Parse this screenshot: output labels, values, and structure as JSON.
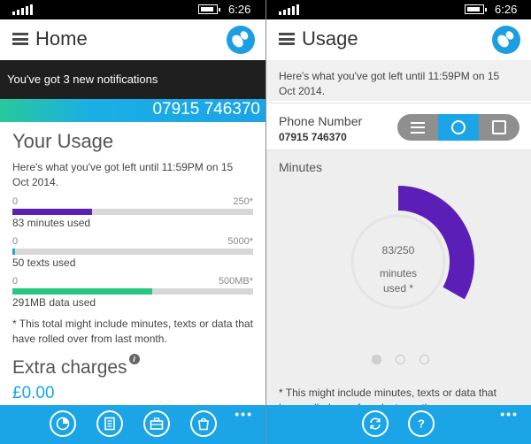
{
  "status_bar": {
    "time": "6:26"
  },
  "home": {
    "header": {
      "title": "Home"
    },
    "notification": "You've got 3 new notifications",
    "phone_number": "07915 746370",
    "usage": {
      "title": "Your Usage",
      "until_text": "Here's what you've got left until 11:59PM on 15 Oct 2014.",
      "meters": [
        {
          "min_label": "0",
          "max_label": "250*",
          "used": 83,
          "total": 250,
          "caption": "83 minutes used",
          "color": "#5b1fb7"
        },
        {
          "min_label": "0",
          "max_label": "5000*",
          "used": 50,
          "total": 5000,
          "caption": "50 texts used",
          "color": "#1ba4e6"
        },
        {
          "min_label": "0",
          "max_label": "500MB*",
          "used": 291,
          "total": 500,
          "caption": "291MB data used",
          "color": "#26c87d"
        }
      ],
      "footnote": "* This total might include minutes, texts or data that have rolled over from last month."
    },
    "extra_charges": {
      "title": "Extra charges",
      "info_glyph": "i",
      "amount": "£0.00"
    },
    "app_bar": {
      "more": "•••",
      "buttons": [
        "pie-chart-icon",
        "document-icon",
        "briefcase-icon",
        "shopping-bag-icon"
      ]
    }
  },
  "usage_page": {
    "header": {
      "title": "Usage"
    },
    "until_text": "Here's what you've got left until 11:59PM on 15 Oct 2014.",
    "phone_label": "Phone Number",
    "phone_number": "07915 746370",
    "view_toggle": {
      "options": [
        "list-view-icon",
        "circle-view-icon",
        "tile-view-icon"
      ],
      "selected": "circle-view-icon"
    },
    "section_title": "Minutes",
    "donut": {
      "used": 83,
      "total": 250,
      "value_text": "83/250",
      "label_line1": "minutes",
      "label_line2": "used *",
      "color": "#5b1fb7"
    },
    "pager": {
      "count": 3,
      "active": 0
    },
    "footnote": "* This might include minutes, texts or data that have rolled over from last month.",
    "app_bar": {
      "more": "•••",
      "buttons": [
        "refresh-icon",
        "help-icon"
      ]
    }
  },
  "colors": {
    "accent": "#1ba4e6",
    "minutes": "#5b1fb7",
    "data": "#26c87d",
    "notification_bg": "#1f1f1f"
  }
}
